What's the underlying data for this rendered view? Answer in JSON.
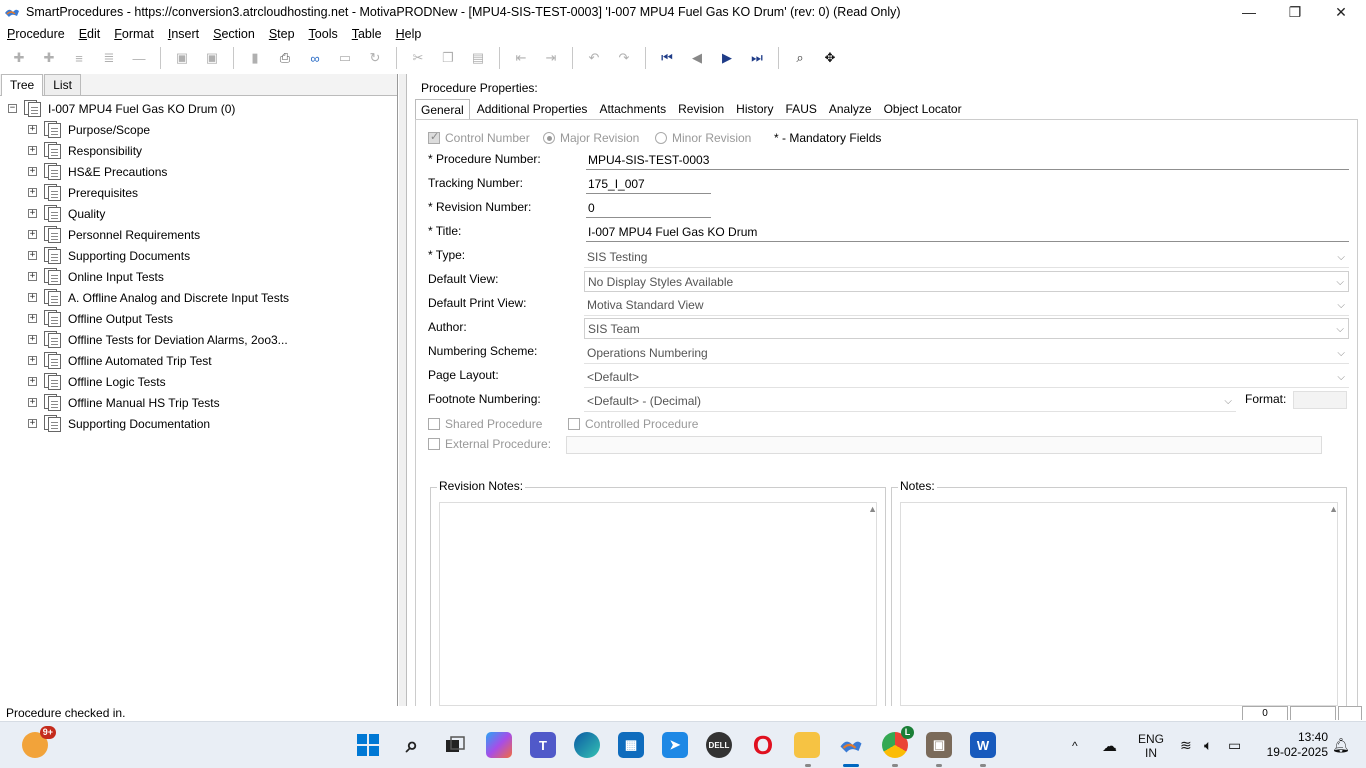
{
  "window": {
    "title": "SmartProcedures - https://conversion3.atrcloudhosting.net - MotivaPRODNew - [MPU4-SIS-TEST-0003] 'I-007 MPU4 Fuel Gas KO Drum' (rev: 0) (Read Only)",
    "minimize": "—",
    "restore": "❐",
    "close": "✕"
  },
  "menu": [
    {
      "u": "P",
      "rest": "rocedure"
    },
    {
      "u": "E",
      "rest": "dit"
    },
    {
      "u": "F",
      "rest": "ormat"
    },
    {
      "u": "I",
      "rest": "nsert"
    },
    {
      "u": "S",
      "rest": "ection"
    },
    {
      "u": "S",
      "rest": "tep"
    },
    {
      "u": "T",
      "rest": "ools"
    },
    {
      "u": "T",
      "rest": "able"
    },
    {
      "u": "H",
      "rest": "elp"
    }
  ],
  "left_tabs": [
    "Tree",
    "List"
  ],
  "tree": {
    "root": "I-007 MPU4 Fuel Gas KO Drum (0)",
    "expand_root": "−",
    "expand": "+",
    "items": [
      "Purpose/Scope",
      "Responsibility",
      "HS&E Precautions",
      "Prerequisites",
      "Quality",
      "Personnel Requirements",
      "Supporting Documents",
      "Online Input Tests",
      "A. Offline Analog and Discrete Input Tests",
      "Offline Output Tests",
      "Offline Tests for Deviation Alarms, 2oo3...",
      "Offline Automated Trip Test",
      "Offline Logic Tests",
      "Offline Manual HS Trip Tests",
      "Supporting Documentation"
    ]
  },
  "props": {
    "header": "Procedure Properties:",
    "tabs": [
      "General",
      "Additional Properties",
      "Attachments",
      "Revision",
      "History",
      "FAUS",
      "Analyze",
      "Object Locator"
    ],
    "control_number": "Control Number",
    "major_revision": "Major Revision",
    "minor_revision": "Minor Revision",
    "mandatory": "* - Mandatory Fields",
    "labels": {
      "procedure_number": "* Procedure Number:",
      "tracking_number": "Tracking Number:",
      "revision_number": "* Revision Number:",
      "title": "* Title:",
      "type": "* Type:",
      "default_view": "Default View:",
      "default_print_view": "Default Print View:",
      "author": "Author:",
      "numbering_scheme": "Numbering Scheme:",
      "page_layout": "Page Layout:",
      "footnote_numbering": "Footnote Numbering:",
      "format": "Format:"
    },
    "values": {
      "procedure_number": "MPU4-SIS-TEST-0003",
      "tracking_number": "175_I_007",
      "revision_number": "0",
      "title": "I-007 MPU4 Fuel Gas KO Drum",
      "type": "SIS Testing",
      "default_view": "No Display Styles Available",
      "default_print_view": "Motiva Standard View",
      "author": "SIS Team",
      "numbering_scheme": "Operations Numbering",
      "page_layout": "<Default>",
      "footnote_numbering": "<Default> - (Decimal)",
      "format": ""
    },
    "shared_procedure": "Shared Procedure",
    "controlled_procedure": "Controlled Procedure",
    "external_procedure": "External Procedure:",
    "revision_notes": "Revision Notes:",
    "notes": "Notes:",
    "dropdown_arrow": "⌵",
    "scroll_up": "▲"
  },
  "status": {
    "text": "Procedure checked in.",
    "panel_value": "0"
  },
  "taskbar": {
    "notification_badge": "9+",
    "chrome_badge": "L",
    "lang_line1": "ENG",
    "lang_line2": "IN",
    "time": "13:40",
    "date": "19-02-2025",
    "tray_chevron": "^"
  }
}
